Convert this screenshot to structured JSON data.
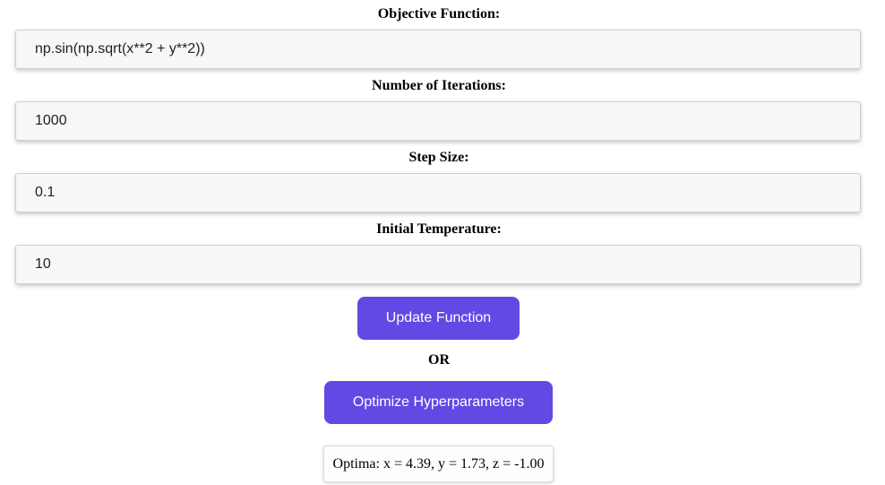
{
  "form": {
    "objective": {
      "label": "Objective Function:",
      "value": "np.sin(np.sqrt(x**2 + y**2))"
    },
    "iterations": {
      "label": "Number of Iterations:",
      "value": "1000"
    },
    "step_size": {
      "label": "Step Size:",
      "value": "0.1"
    },
    "temperature": {
      "label": "Initial Temperature:",
      "value": "10"
    }
  },
  "actions": {
    "update_label": "Update Function",
    "or_text": "OR",
    "optimize_label": "Optimize Hyperparameters"
  },
  "result": {
    "text": "Optima: x = 4.39, y = 1.73, z = -1.00"
  },
  "colors": {
    "button_bg": "#6349e3",
    "input_bg": "#f7f7f7"
  }
}
